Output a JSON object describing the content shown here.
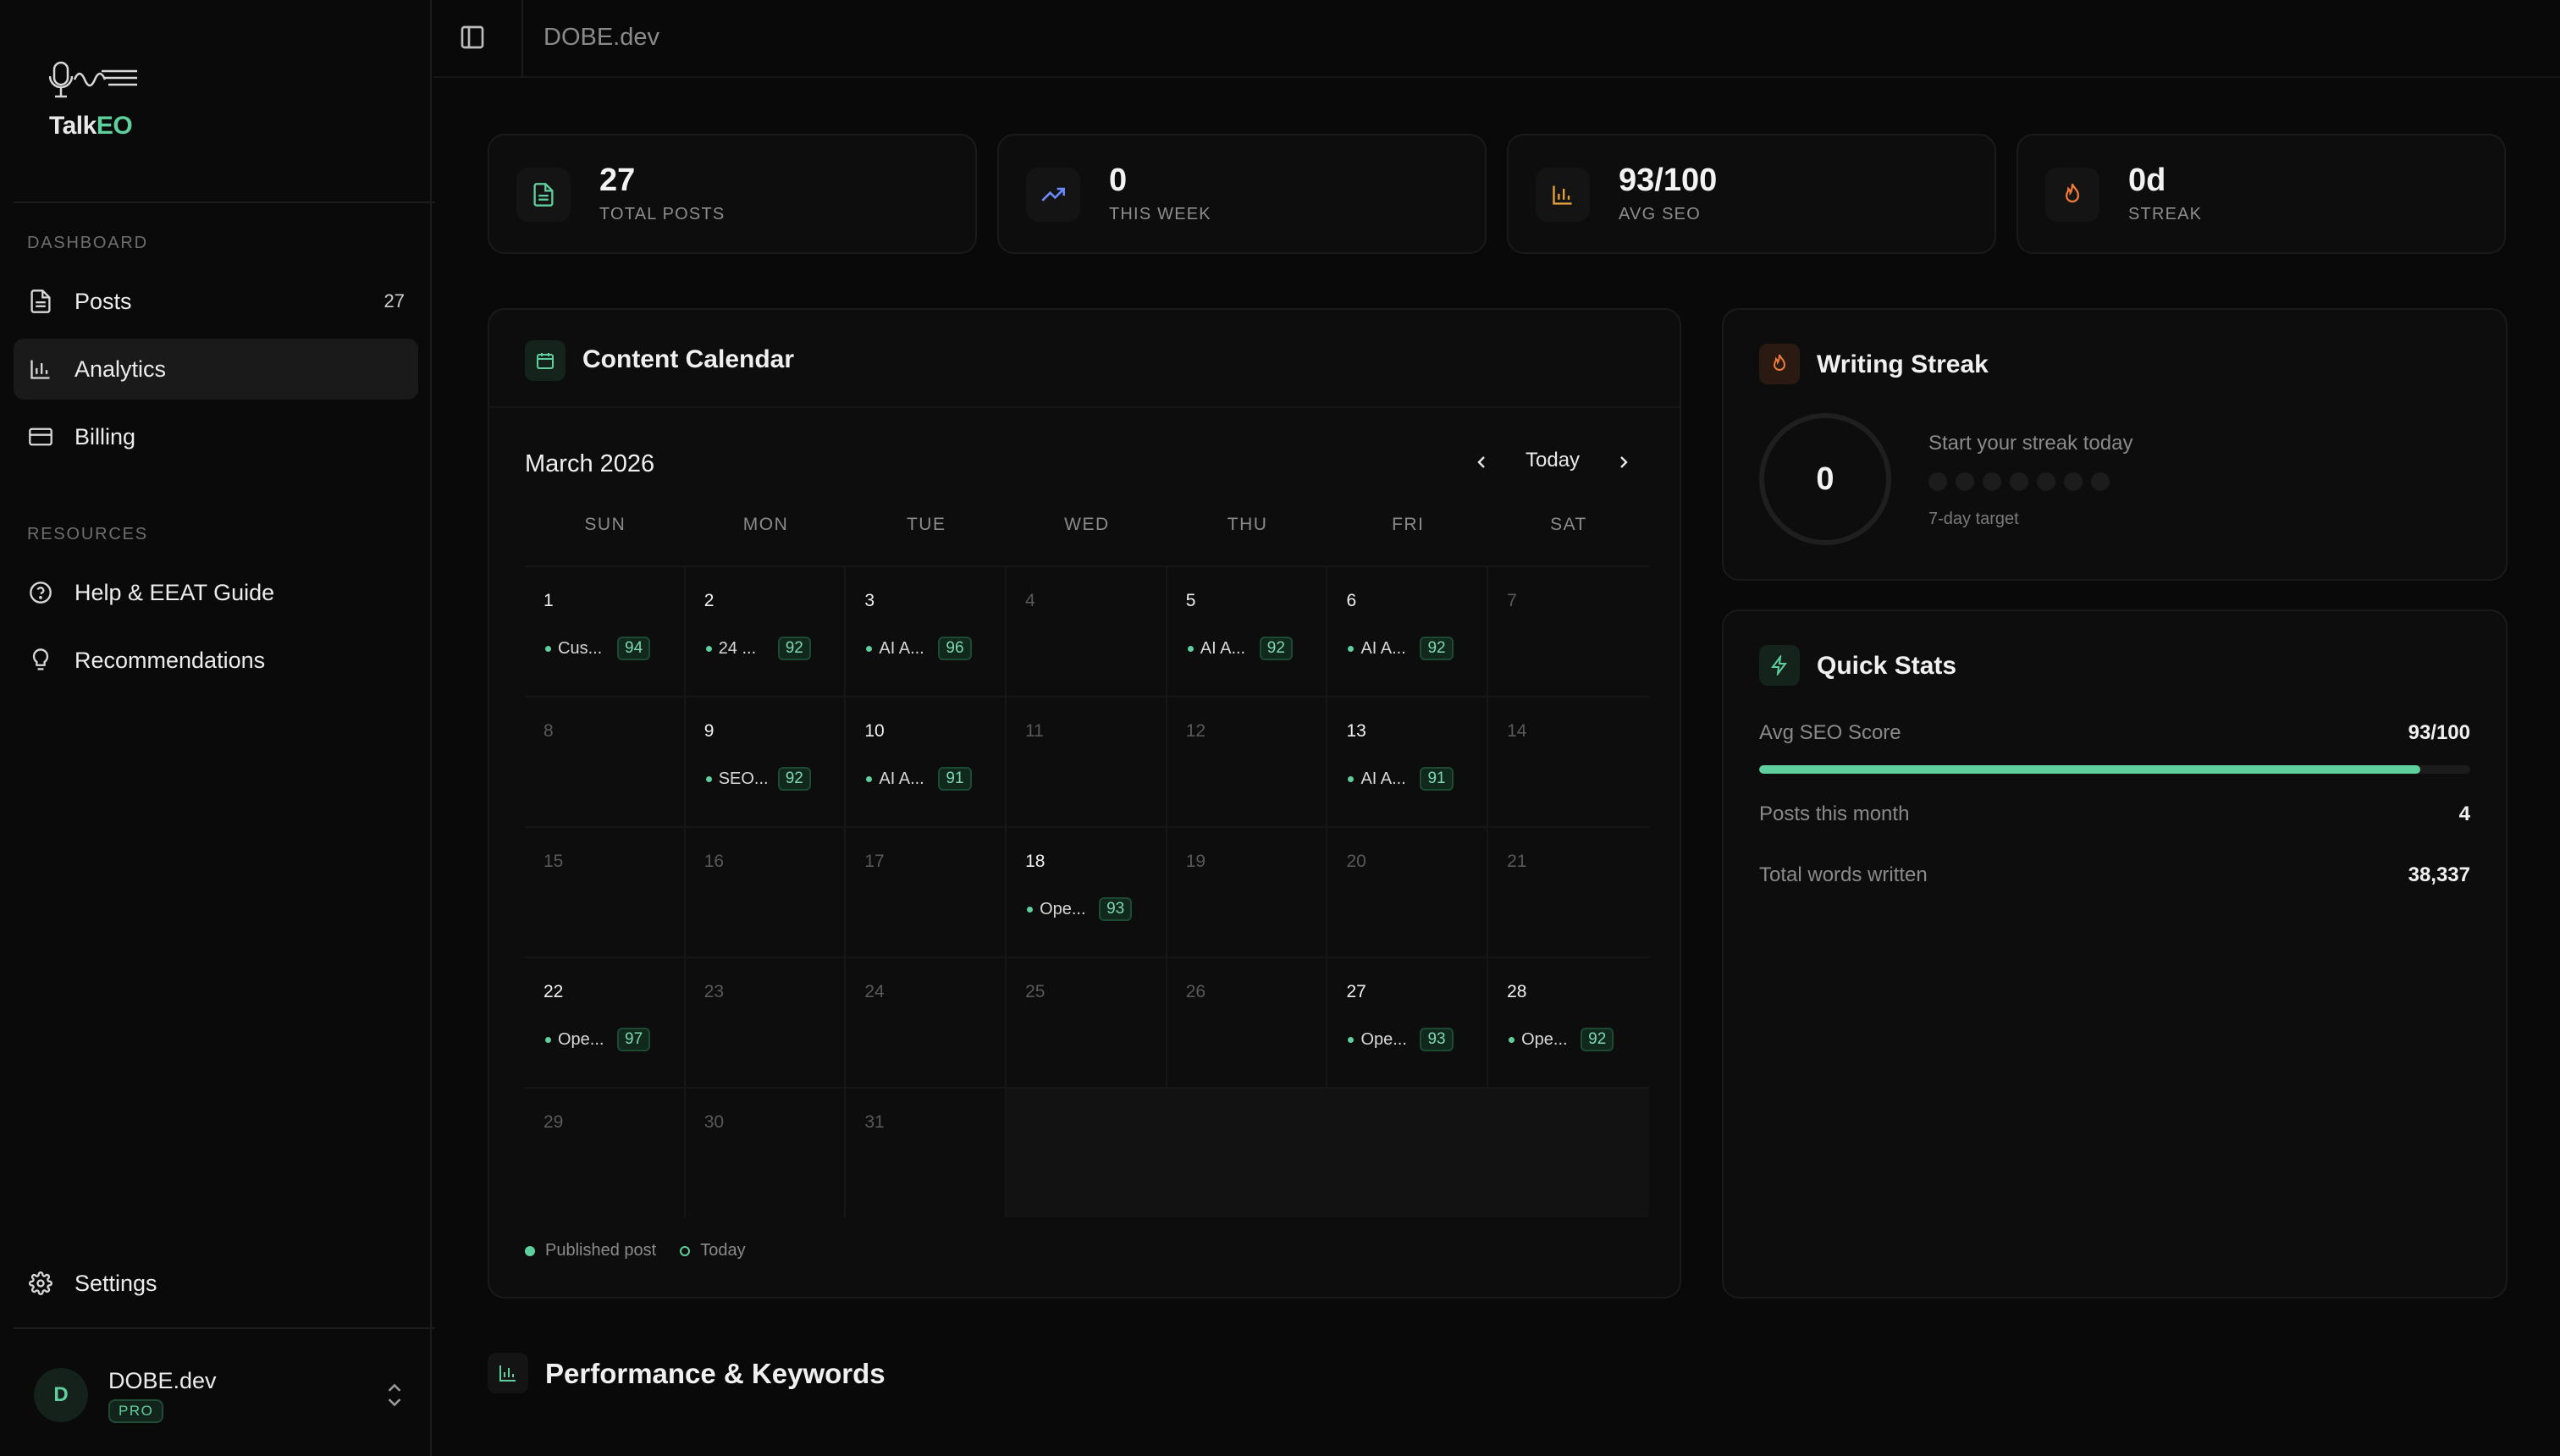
{
  "brand": {
    "name_part1": "Talk",
    "name_part2": "EO"
  },
  "topbar": {
    "title": "DOBE.dev"
  },
  "sidebar": {
    "sections": [
      {
        "label": "DASHBOARD"
      },
      {
        "label": "RESOURCES"
      }
    ],
    "items": [
      {
        "label": "Posts",
        "badge": "27",
        "icon": "file-text-icon"
      },
      {
        "label": "Analytics",
        "icon": "bar-chart-icon",
        "active": true
      },
      {
        "label": "Billing",
        "icon": "credit-card-icon"
      },
      {
        "label": "Help & EEAT Guide",
        "icon": "help-circle-icon"
      },
      {
        "label": "Recommendations",
        "icon": "lightbulb-icon"
      },
      {
        "label": "Settings",
        "icon": "gear-icon"
      }
    ],
    "user": {
      "initial": "D",
      "name": "DOBE.dev",
      "plan": "PRO"
    }
  },
  "stats": [
    {
      "value": "27",
      "label": "TOTAL POSTS",
      "icon": "file-text-icon",
      "color": "#5fcf9e"
    },
    {
      "value": "0",
      "label": "THIS WEEK",
      "icon": "trending-up-icon",
      "color": "#6b8cff"
    },
    {
      "value": "93/100",
      "label": "AVG SEO",
      "icon": "bar-chart-icon",
      "color": "#e6a23c"
    },
    {
      "value": "0d",
      "label": "STREAK",
      "icon": "flame-icon",
      "color": "#f07a3a"
    }
  ],
  "calendar": {
    "title": "Content Calendar",
    "month": "March 2026",
    "today_label": "Today",
    "weekdays": [
      "SUN",
      "MON",
      "TUE",
      "WED",
      "THU",
      "FRI",
      "SAT"
    ],
    "weeks": [
      [
        {
          "day": "1",
          "post": "Cus...",
          "score": "94"
        },
        {
          "day": "2",
          "post": "24 ...",
          "score": "92"
        },
        {
          "day": "3",
          "post": "AI A...",
          "score": "96"
        },
        {
          "day": "4",
          "muted": true
        },
        {
          "day": "5",
          "post": "AI A...",
          "score": "92"
        },
        {
          "day": "6",
          "post": "AI A...",
          "score": "92"
        },
        {
          "day": "7",
          "muted": true
        }
      ],
      [
        {
          "day": "8",
          "muted": true
        },
        {
          "day": "9",
          "post": "SEO...",
          "score": "92"
        },
        {
          "day": "10",
          "post": "AI A...",
          "score": "91"
        },
        {
          "day": "11",
          "muted": true
        },
        {
          "day": "12",
          "muted": true
        },
        {
          "day": "13",
          "post": "AI A...",
          "score": "91"
        },
        {
          "day": "14",
          "muted": true
        }
      ],
      [
        {
          "day": "15",
          "muted": true
        },
        {
          "day": "16",
          "muted": true
        },
        {
          "day": "17",
          "muted": true
        },
        {
          "day": "18",
          "post": "Ope...",
          "score": "93"
        },
        {
          "day": "19",
          "muted": true
        },
        {
          "day": "20",
          "muted": true
        },
        {
          "day": "21",
          "muted": true
        }
      ],
      [
        {
          "day": "22",
          "post": "Ope...",
          "score": "97"
        },
        {
          "day": "23",
          "muted": true
        },
        {
          "day": "24",
          "muted": true
        },
        {
          "day": "25",
          "muted": true
        },
        {
          "day": "26",
          "muted": true
        },
        {
          "day": "27",
          "post": "Ope...",
          "score": "93"
        },
        {
          "day": "28",
          "post": "Ope...",
          "score": "92"
        }
      ],
      [
        {
          "day": "29",
          "muted": true
        },
        {
          "day": "30",
          "muted": true
        },
        {
          "day": "31",
          "muted": true
        },
        {
          "filler": true
        },
        {
          "filler": true
        },
        {
          "filler": true
        },
        {
          "filler": true
        }
      ]
    ],
    "legend": {
      "published": "Published post",
      "today": "Today"
    }
  },
  "streak": {
    "title": "Writing Streak",
    "value": "0",
    "message": "Start your streak today",
    "target": "7-day target",
    "dot_count": 7
  },
  "quick_stats": {
    "title": "Quick Stats",
    "seo_label": "Avg SEO Score",
    "seo_value": "93/100",
    "seo_fraction": 0.93,
    "posts_label": "Posts this month",
    "posts_value": "4",
    "words_label": "Total words written",
    "words_value": "38,337"
  },
  "performance": {
    "title": "Performance & Keywords"
  },
  "colors": {
    "accent": "#5fcf9e",
    "background": "#090909",
    "card": "#0d0d0d"
  }
}
